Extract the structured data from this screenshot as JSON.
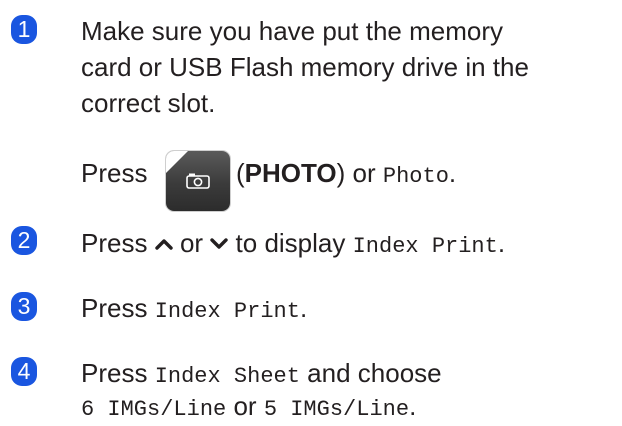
{
  "steps": [
    {
      "number": "1",
      "lines": [
        "Make sure you have put the memory",
        "card or USB Flash memory drive in the",
        "correct slot."
      ],
      "press_line": {
        "press": "Press",
        "button_label": "PHOTO",
        "or": "or",
        "menu_item": "Photo",
        "end": "."
      }
    },
    {
      "number": "2",
      "press": "Press",
      "or": "or",
      "to_display": "to display",
      "menu_item": "Index Print",
      "end": "."
    },
    {
      "number": "3",
      "press": "Press",
      "menu_item": "Index Print",
      "end": "."
    },
    {
      "number": "4",
      "press": "Press",
      "menu_item": "Index Sheet",
      "and_choose": "and choose",
      "option_1": "6 IMGs/Line",
      "or": "or",
      "option_2": "5 IMGs/Line",
      "end": "."
    }
  ],
  "icons": {
    "up": "chevron-up-icon",
    "down": "chevron-down-icon",
    "photo": "camera-icon"
  },
  "colors": {
    "step_badge": "#1a56e0",
    "text": "#231f20"
  }
}
